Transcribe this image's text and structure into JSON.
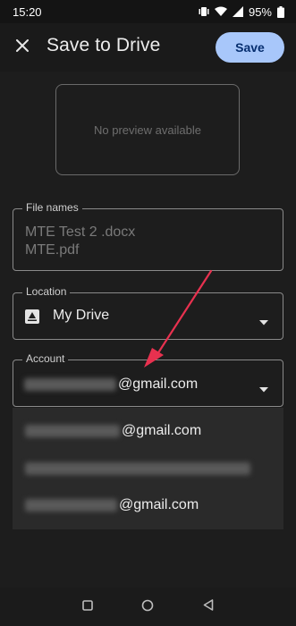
{
  "status_bar": {
    "time": "15:20",
    "battery": "95%",
    "icons": [
      "vibrate-icon",
      "wifi-icon",
      "signal-icon",
      "battery-icon"
    ]
  },
  "app_bar": {
    "title": "Save to Drive",
    "save_label": "Save",
    "close_icon": "close-icon"
  },
  "preview": {
    "text": "No preview available"
  },
  "file_names": {
    "label": "File names",
    "files": [
      "MTE Test 2 .docx",
      "MTE.pdf"
    ]
  },
  "location": {
    "label": "Location",
    "value": "My Drive",
    "icon": "drive-icon"
  },
  "account": {
    "label": "Account",
    "selected_suffix": "@gmail.com",
    "options": [
      {
        "suffix": "@gmail.com"
      },
      {
        "suffix": ""
      },
      {
        "suffix": "@gmail.com"
      }
    ]
  },
  "colors": {
    "accent": "#a8c7fa",
    "annotation_arrow": "#e8314f",
    "background": "#1d1d1d"
  }
}
